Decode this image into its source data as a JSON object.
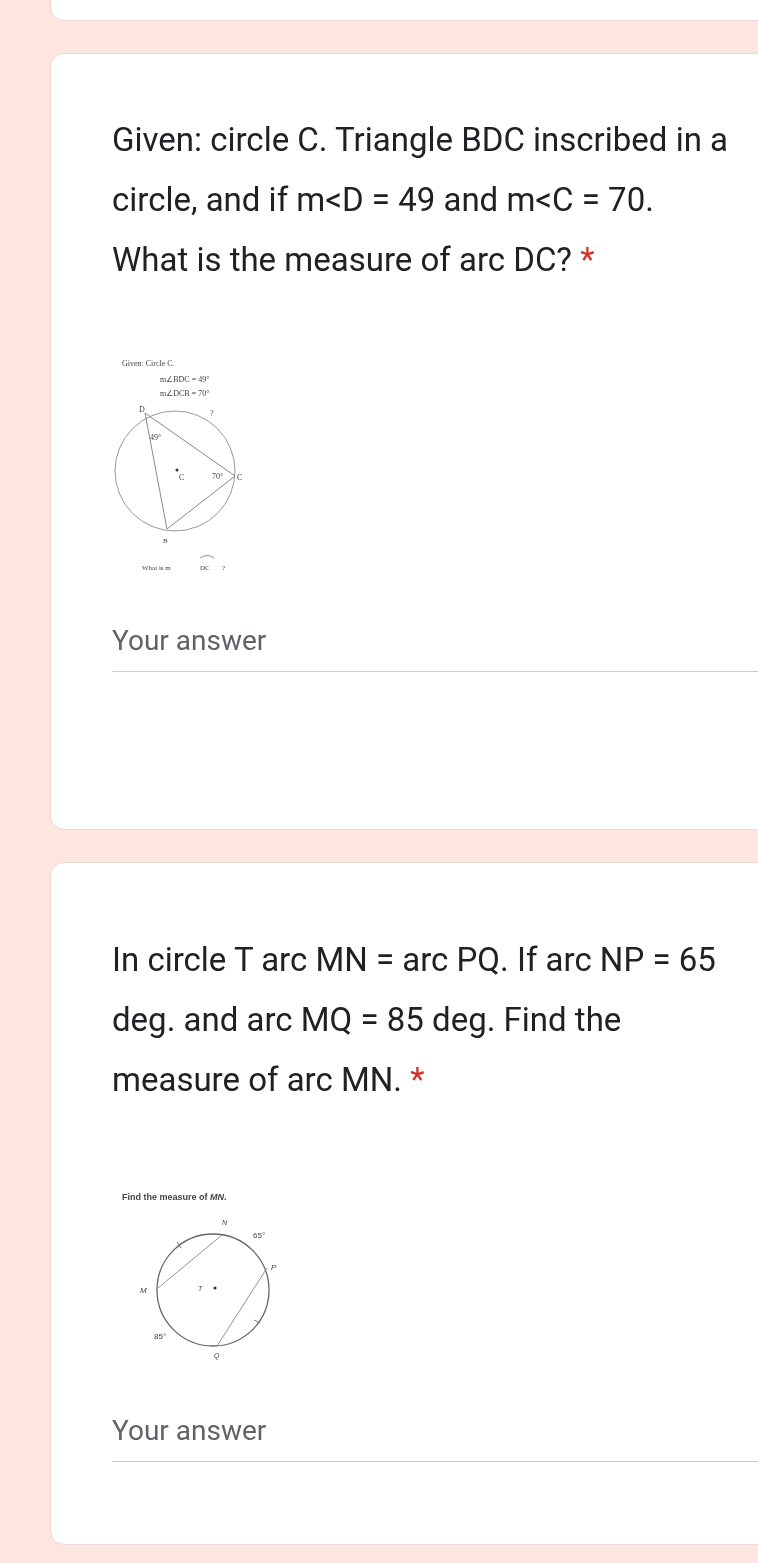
{
  "questions": [
    {
      "text": "Given: circle C. Triangle BDC inscribed in a circle, and if m<D = 49 and m<C = 70. What is the measure of arc DC?",
      "required_mark": "*",
      "figure": {
        "kind": "inscribed-triangle",
        "title": "Given: Circle C.",
        "givens": [
          "m∠BDC = 49°",
          "m∠DCB = 70°"
        ],
        "labels": [
          "D",
          "?",
          "49°",
          "C",
          "70°",
          "C",
          "B"
        ],
        "question": [
          "What is m",
          "DC",
          "?"
        ]
      },
      "answer": {
        "placeholder": "Your answer"
      }
    },
    {
      "text": "In circle T arc MN = arc PQ. If arc NP = 65 deg. and arc MQ = 85 deg. Find the measure of arc MN.",
      "required_mark": "*",
      "figure": {
        "kind": "parallel-chords",
        "title": [
          "Find the measure of ",
          "MN",
          "."
        ],
        "labels": [
          "N",
          "65°",
          "P",
          "M",
          "T",
          "85°",
          "Q"
        ]
      },
      "answer": {
        "placeholder": "Your answer"
      }
    }
  ]
}
